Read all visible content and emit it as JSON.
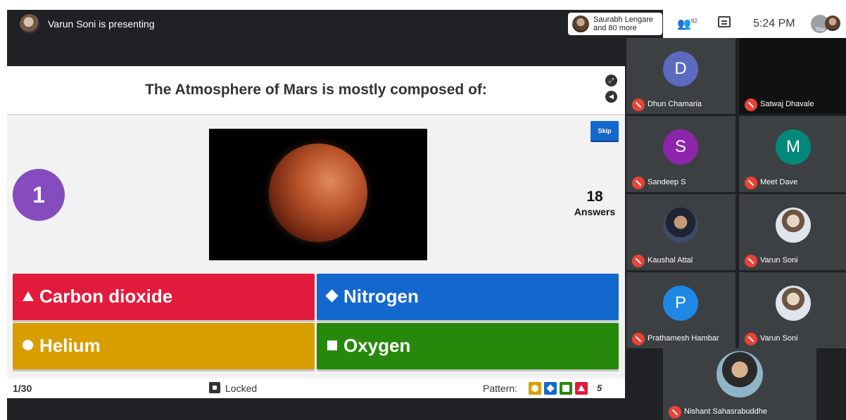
{
  "topbar": {
    "presenter_text": "Varun Soni is presenting",
    "participants_chip_line1": "Saurabh Lengare",
    "participants_chip_line2": "and 80 more",
    "people_count": "92",
    "time": "5:24 PM",
    "you_label": "You"
  },
  "quiz": {
    "question": "The Atmosphere of Mars is mostly composed of:",
    "question_number": "1",
    "skip_label": "Skip",
    "answers_count": "18",
    "answers_label": "Answers",
    "options": [
      {
        "label": "Carbon dioxide",
        "color": "#e21b3c",
        "icon": "triangle-icon"
      },
      {
        "label": "Nitrogen",
        "color": "#1368ce",
        "icon": "diamond-icon"
      },
      {
        "label": "Helium",
        "color": "#d89e00",
        "icon": "circle-icon"
      },
      {
        "label": "Oxygen",
        "color": "#26890c",
        "icon": "square-icon"
      }
    ],
    "footer": {
      "progress": "1/30",
      "locked_label": "Locked",
      "pattern_label": "Pattern:",
      "pattern_count": "5"
    }
  },
  "participants": [
    {
      "name": "Dhun Chamaria",
      "initial": "D",
      "color": "#5c6bc0"
    },
    {
      "name": "Satwaj Dhavale",
      "initial": "",
      "color": ""
    },
    {
      "name": "Sandeep S",
      "initial": "S",
      "color": "#8e24aa"
    },
    {
      "name": "Meet Dave",
      "initial": "M",
      "color": "#00897b"
    },
    {
      "name": "Kaushal Attal",
      "initial": "",
      "color": ""
    },
    {
      "name": "Varun Soni",
      "initial": "",
      "color": ""
    },
    {
      "name": "Prathamesh Hambar",
      "initial": "P",
      "color": "#1e88e5"
    },
    {
      "name": "Varun Soni",
      "initial": "",
      "color": ""
    },
    {
      "name": "Nishant Sahasrabuddhe",
      "initial": "",
      "color": ""
    }
  ]
}
